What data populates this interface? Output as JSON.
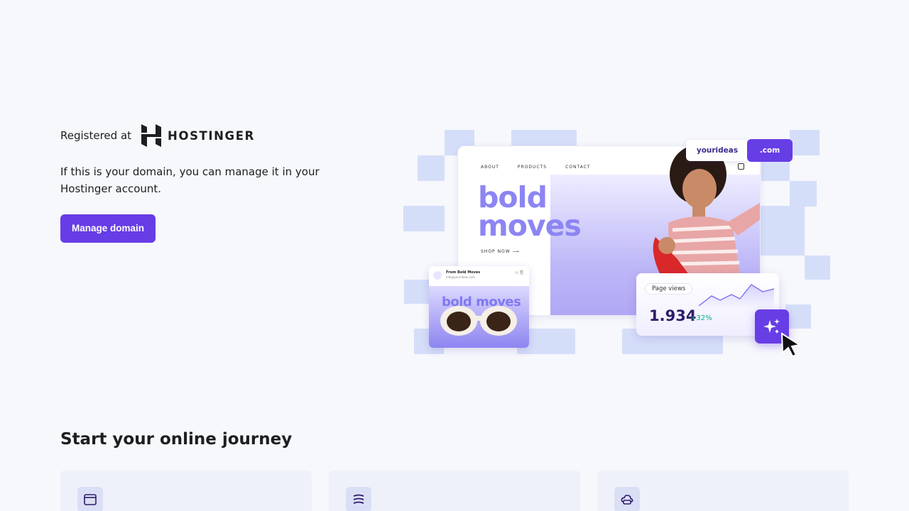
{
  "hero": {
    "registered_label": "Registered at",
    "brand_name": "HOSTINGER",
    "description": "If this is your domain, you can manage it in your Hostinger account.",
    "manage_button": "Manage domain"
  },
  "illustration": {
    "nav": [
      "ABOUT",
      "PRODUCTS",
      "CONTACT"
    ],
    "headline_line1": "bold",
    "headline_line2": "moves",
    "shop_now": "SHOP NOW",
    "domain_name": "yourideas",
    "domain_tld": ".com",
    "email": {
      "from": "From Bold Moves",
      "address": "info@yourideas.com",
      "banner": "bold moves"
    },
    "stats": {
      "label": "Page views",
      "value": "1.934",
      "change": "+32%"
    }
  },
  "journey": {
    "title": "Start your online journey",
    "cards": [
      {
        "icon": "browser-window-icon"
      },
      {
        "icon": "layers-icon"
      },
      {
        "icon": "cloud-hosting-icon"
      }
    ]
  },
  "colors": {
    "accent": "#673de6",
    "background": "#f7f8fc",
    "checker": "#d5def9",
    "positive": "#00b090"
  }
}
